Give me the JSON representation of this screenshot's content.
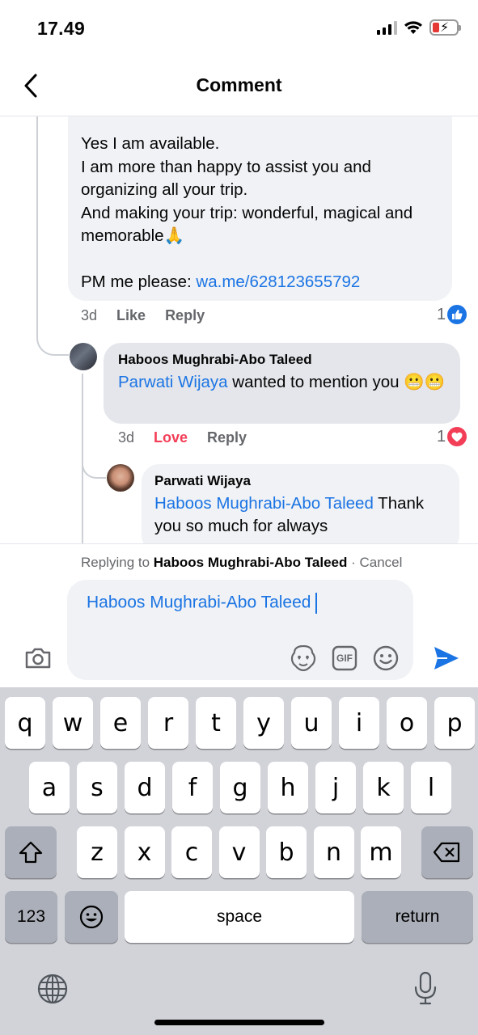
{
  "status": {
    "time": "17.49"
  },
  "header": {
    "title": "Comment"
  },
  "comments": {
    "first": {
      "lines": [
        "Yes I am available.",
        "I am more than happy to assist you and organizing all your trip.",
        "And making your trip: wonderful, magical and memorable🙏"
      ],
      "pm_prefix": "PM me please: ",
      "pm_link": "wa.me/628123655792",
      "time": "3d",
      "like": "Like",
      "reply": "Reply",
      "reaction_count": "1"
    },
    "second": {
      "author": "Haboos Mughrabi-Abo Taleed",
      "mention": "Parwati Wijaya",
      "text": " wanted to mention you 😬😬",
      "time": "3d",
      "love": "Love",
      "reply": "Reply",
      "reaction_count": "1"
    },
    "third": {
      "author": "Parwati Wijaya",
      "mention": "Haboos Mughrabi-Abo Taleed",
      "text": " Thank you so much for always"
    }
  },
  "composer": {
    "replying_prefix": "Replying to ",
    "replying_name": "Haboos Mughrabi-Abo Taleed",
    "cancel": " · Cancel",
    "input_mention": "Haboos Mughrabi-Abo Taleed",
    "gif_label": "GIF"
  },
  "keyboard": {
    "row1": [
      "q",
      "w",
      "e",
      "r",
      "t",
      "y",
      "u",
      "i",
      "o",
      "p"
    ],
    "row2": [
      "a",
      "s",
      "d",
      "f",
      "g",
      "h",
      "j",
      "k",
      "l"
    ],
    "row3": [
      "z",
      "x",
      "c",
      "v",
      "b",
      "n",
      "m"
    ],
    "numbers": "123",
    "space": "space",
    "return": "return"
  },
  "colors": {
    "link": "#1b74e4",
    "love": "#f33e58"
  }
}
